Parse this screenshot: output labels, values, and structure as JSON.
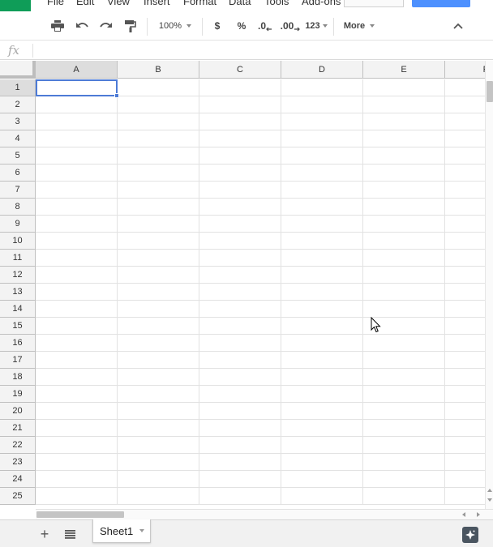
{
  "menu": {
    "items": [
      "File",
      "Edit",
      "View",
      "Insert",
      "Format",
      "Data",
      "Tools",
      "Add-ons"
    ]
  },
  "toolbar": {
    "zoom": "100%",
    "currency_label": "$",
    "percent_label": "%",
    "decrease_decimal_label": ".0",
    "increase_decimal_label": ".00",
    "format_more_label": "123",
    "more_label": "More"
  },
  "formula_bar": {
    "fx_label": "fx",
    "value": ""
  },
  "grid": {
    "columns": [
      "A",
      "B",
      "C",
      "D",
      "E",
      "F"
    ],
    "rows": [
      "1",
      "2",
      "3",
      "4",
      "5",
      "6",
      "7",
      "8",
      "9",
      "10",
      "11",
      "12",
      "13",
      "14",
      "15",
      "16",
      "17",
      "18",
      "19",
      "20",
      "21",
      "22",
      "23",
      "24",
      "25"
    ],
    "selected_cell": "A1"
  },
  "sheets": {
    "tabs": [
      "Sheet1"
    ],
    "active": "Sheet1"
  },
  "colors": {
    "logo_green": "#0f9d58",
    "share_blue": "#4d90fe",
    "selection_blue": "#4d7bd6",
    "header_bg": "#f3f3f3",
    "header_active_bg": "#dddddd"
  }
}
